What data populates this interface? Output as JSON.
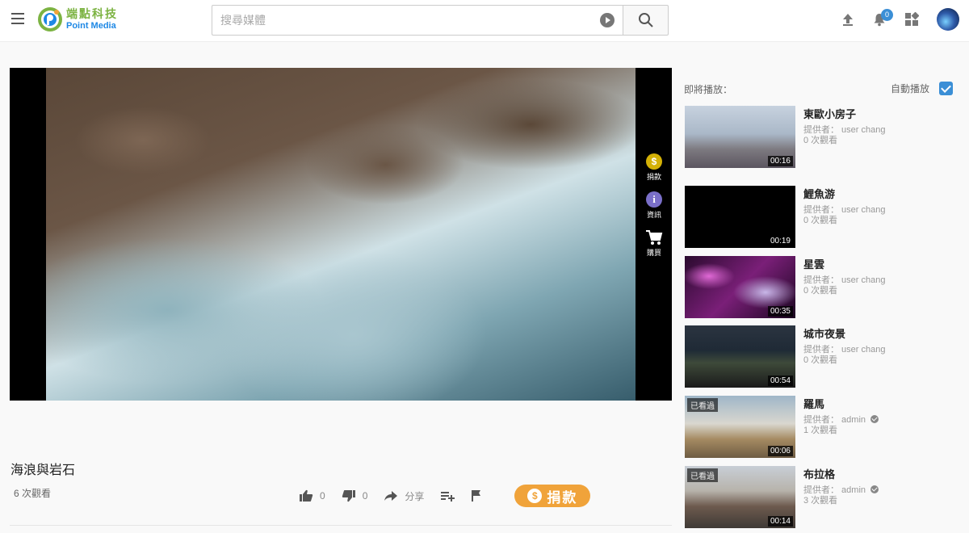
{
  "brand": {
    "zh": "端點科技",
    "en": "Point Media"
  },
  "search": {
    "placeholder": "搜尋媒體"
  },
  "notifications": {
    "count": "0"
  },
  "video": {
    "title": "海浪與岩石",
    "views": "6 次觀看"
  },
  "player_tools": [
    {
      "label": "捐款",
      "icon": "coin-icon"
    },
    {
      "label": "資訊",
      "icon": "info-icon"
    },
    {
      "label": "購買",
      "icon": "cart-icon"
    }
  ],
  "actions": {
    "likes": "0",
    "dislikes": "0",
    "share": "分享",
    "donate": "捐款"
  },
  "sidebar": {
    "up_next": "即將播放：",
    "autoplay": "自動播放",
    "autoplay_on": true,
    "items": [
      {
        "title": "東歐小房子",
        "provider": "提供者： user chang",
        "views": "0 次觀看",
        "duration": "00:16",
        "watched": "",
        "verified": false
      },
      {
        "title": "鯉魚游",
        "provider": "提供者： user chang",
        "views": "0 次觀看",
        "duration": "00:19",
        "watched": "",
        "verified": false
      },
      {
        "title": "星雲",
        "provider": "提供者： user chang",
        "views": "0 次觀看",
        "duration": "00:35",
        "watched": "",
        "verified": false
      },
      {
        "title": "城市夜景",
        "provider": "提供者： user chang",
        "views": "0 次觀看",
        "duration": "00:54",
        "watched": "",
        "verified": false
      },
      {
        "title": "羅馬",
        "provider": "提供者： admin",
        "views": "1 次觀看",
        "duration": "00:06",
        "watched": "已看過",
        "verified": true
      },
      {
        "title": "布拉格",
        "provider": "提供者： admin",
        "views": "3 次觀看",
        "duration": "00:14",
        "watched": "已看過",
        "verified": true
      }
    ]
  },
  "colors": {
    "accent": "#3b8fd6",
    "donate": "#f0a33a",
    "brand_green": "#7cb342",
    "brand_blue": "#1e88e5"
  }
}
